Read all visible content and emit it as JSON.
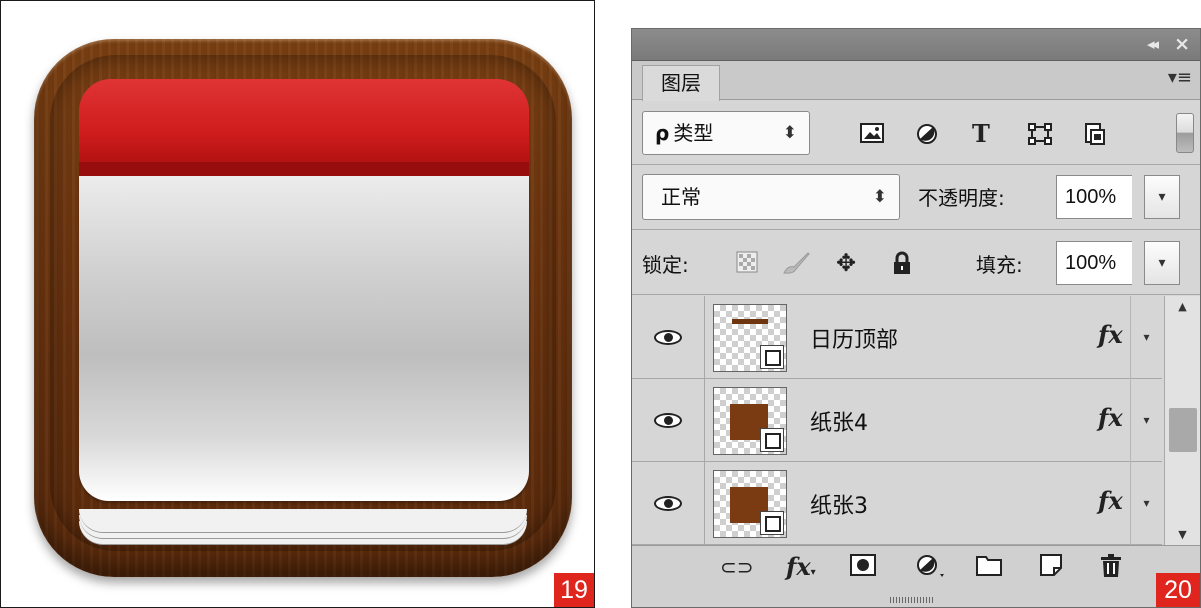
{
  "figures": {
    "left_number": "19",
    "right_number": "20"
  },
  "panel": {
    "titlebar": {
      "collapse_icon": "double-chevron-left",
      "close_icon": "close-x"
    },
    "tab_label": "图层",
    "menu_icon": "panel-menu",
    "filter": {
      "kind_label": "类型",
      "search_glyph": "ρ",
      "icons": [
        "image-icon",
        "adjustment-icon",
        "type-icon",
        "shape-icon",
        "smart-object-icon"
      ]
    },
    "blend": {
      "mode": "正常",
      "opacity_label": "不透明度:",
      "opacity_value": "100%"
    },
    "lock": {
      "label": "锁定:",
      "fill_label": "填充:",
      "fill_value": "100%"
    },
    "layers": [
      {
        "name": "日历顶部",
        "fx": "fx"
      },
      {
        "name": "纸张4",
        "fx": "fx"
      },
      {
        "name": "纸张3",
        "fx": "fx"
      }
    ],
    "bottom_icons": [
      "link-icon",
      "fx-icon",
      "mask-icon",
      "adjustment-icon",
      "folder-icon",
      "new-layer-icon",
      "trash-icon"
    ]
  }
}
